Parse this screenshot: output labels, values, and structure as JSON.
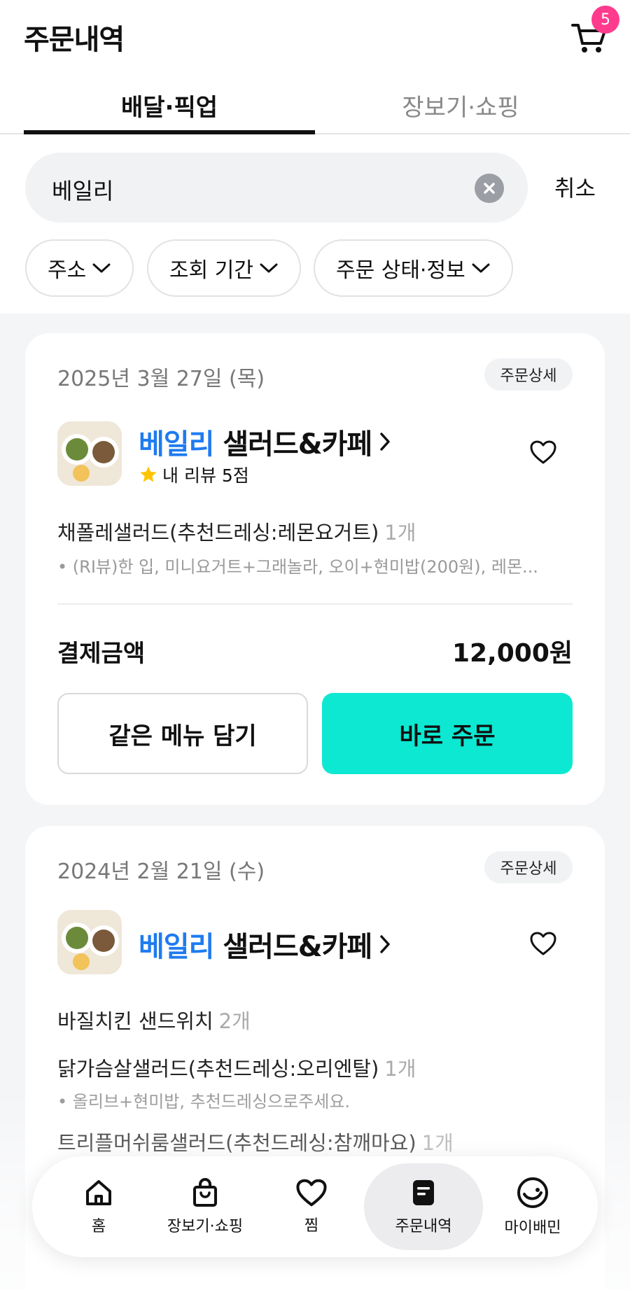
{
  "header": {
    "title": "주문내역",
    "cart_count": "5"
  },
  "tabs": [
    {
      "label": "배달·픽업",
      "active": true
    },
    {
      "label": "장보기·쇼핑",
      "active": false
    }
  ],
  "search": {
    "value": "베일리",
    "cancel_label": "취소"
  },
  "filters": [
    {
      "label": "주소"
    },
    {
      "label": "조회 기간"
    },
    {
      "label": "주문 상태·정보"
    }
  ],
  "orders": [
    {
      "date": "2025년 3월 27일 (목)",
      "detail_label": "주문상세",
      "store_highlight": "베일리",
      "store_rest": "샐러드&카페",
      "review": "내 리뷰 5점",
      "items": [
        {
          "name": "채폴레샐러드(추천드레싱:레몬요거트)",
          "qty": "1개",
          "options": "• (RI뷰)한 입, 미니요거트+그래놀라, 오이+현미밥(200원), 레몬..."
        }
      ],
      "pay_label": "결제금액",
      "pay_value": "12,000원",
      "button_secondary": "같은 메뉴 담기",
      "button_primary": "바로 주문"
    },
    {
      "date": "2024년 2월 21일 (수)",
      "detail_label": "주문상세",
      "store_highlight": "베일리",
      "store_rest": "샐러드&카페",
      "items": [
        {
          "name": "바질치킨 샌드위치",
          "qty": "2개"
        },
        {
          "name": "닭가슴살샐러드(추천드레싱:오리엔탈)",
          "qty": "1개",
          "options": "• 올리브+현미밥, 추천드레싱으로주세요."
        },
        {
          "name": "트리플머쉬룸샐러드(추천드레싱:참깨마요)",
          "qty": "1개"
        }
      ]
    }
  ],
  "bottom_nav": [
    {
      "label": "홈",
      "icon": "home-icon"
    },
    {
      "label": "장보기·쇼핑",
      "icon": "shopping-bag-icon"
    },
    {
      "label": "찜",
      "icon": "heart-icon"
    },
    {
      "label": "주문내역",
      "icon": "order-list-icon",
      "active": true
    },
    {
      "label": "마이배민",
      "icon": "my-baemin-icon"
    }
  ],
  "colors": {
    "accent_mint": "#0de8d2",
    "highlight_blue": "#1e7bf0",
    "badge_pink": "#ff3b8d"
  }
}
